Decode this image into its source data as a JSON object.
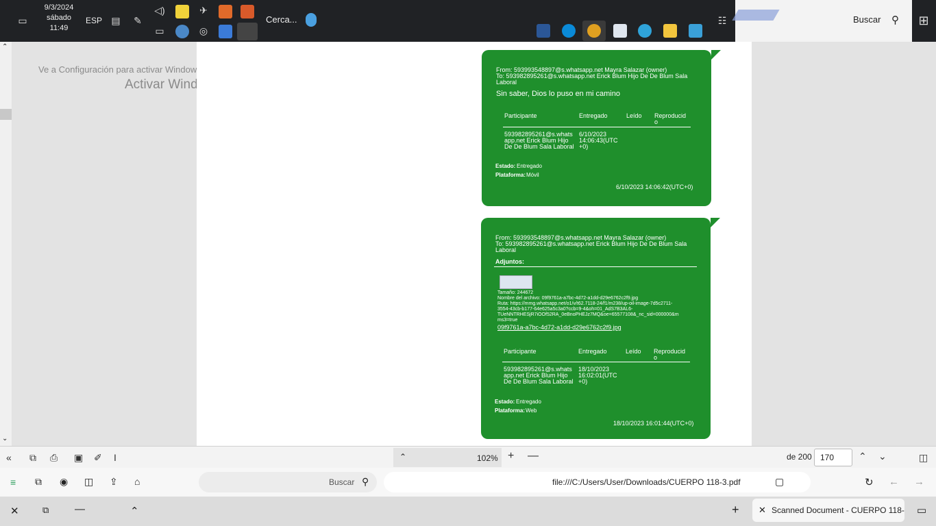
{
  "taskbar": {
    "search_label": "Buscar",
    "weather_label": "Cerca...",
    "language": "ESP",
    "time": "11:49",
    "day": "sábado",
    "date": "9/3/2024"
  },
  "watermark": {
    "title": "Activar Windows",
    "subtitle": "Ve a Configuración para activar Windows."
  },
  "messages": [
    {
      "from": "From: 593993548897@s.whatsapp.net Mayra Salazar (owner)",
      "to_line1": "To: 593982895261@s.whatsapp.net Erick Blum Hijo De De Blum Sala",
      "to_line2": "Laboral",
      "body": "Sin saber, Dios lo puso en mi camino",
      "headers": [
        "Participante",
        "Entregado",
        "Leído",
        "Reproducid",
        "o"
      ],
      "participant": [
        "593982895261@s.whats",
        "app.net Erick Blum Hijo",
        "De De Blum Sala Laboral"
      ],
      "delivered": [
        "6/10/2023",
        "14:06:43(UTC",
        "+0)"
      ],
      "estado_label": "Estado:",
      "estado": "Entregado",
      "plataforma_label": "Plataforma:",
      "plataforma": "Móvil",
      "timestamp": "6/10/2023 14:06:42(UTC+0)"
    },
    {
      "from": "From: 593993548897@s.whatsapp.net Mayra Salazar (owner)",
      "to_line1": "To: 593982895261@s.whatsapp.net Erick Blum Hijo De De Blum Sala",
      "to_line2": "Laboral",
      "attachments_label": "Adjuntos:",
      "size": "Tamaño: 244672",
      "filename_line": "Nombre del archivo: 09f9761a-a7bc-4d72-a1dd-d29e6762c2f9.jpg",
      "route1": "Ruta: https://mmg.whatsapp.net/o1/v/t62.7118-24/f1/m238/up-oil-image-7d5c2711-",
      "route2": "3554-43cb-b177-64e625a5c3a0?ccb=9-4&oh=01_AdS7B3AL6-",
      "route3": "TUeNNTRHESjR7iOOf52RA_0eBnoPHEJz7MQ&oe=65577108&_nc_sid=000000&m",
      "route4": "ms3=true",
      "file_link": "09f9761a-a7bc-4d72-a1dd-d29e6762c2f9.jpg",
      "headers": [
        "Participante",
        "Entregado",
        "Leído",
        "Reproducid",
        "o"
      ],
      "participant": [
        "593982895261@s.whats",
        "app.net Erick Blum Hijo",
        "De De Blum Sala Laboral"
      ],
      "delivered": [
        "18/10/2023",
        "16:02:01(UTC",
        "+0)"
      ],
      "estado_label": "Estado:",
      "estado": "Entregado",
      "plataforma_label": "Plataforma:",
      "plataforma": "Web",
      "timestamp": "18/10/2023 16:01:44(UTC+0)"
    }
  ],
  "pdf_toolbar": {
    "page_current": "170",
    "page_total": "de 200",
    "zoom": "102%"
  },
  "address": {
    "url": "file:///C:/Users/User/Downloads/CUERPO 118-3.pdf",
    "search_placeholder": "Buscar"
  },
  "tab": {
    "title": "Scanned Document - CUERPO 118-"
  }
}
